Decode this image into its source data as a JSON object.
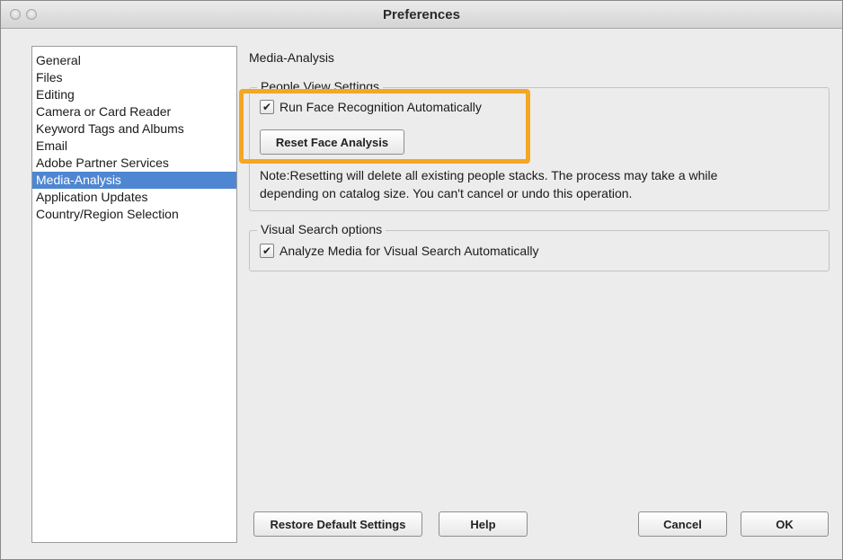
{
  "window": {
    "title": "Preferences"
  },
  "sidebar": {
    "items": [
      {
        "label": "General"
      },
      {
        "label": "Files"
      },
      {
        "label": "Editing"
      },
      {
        "label": "Camera or Card Reader"
      },
      {
        "label": "Keyword Tags and Albums"
      },
      {
        "label": "Email"
      },
      {
        "label": "Adobe Partner Services"
      },
      {
        "label": "Media-Analysis",
        "selected": true
      },
      {
        "label": "Application Updates"
      },
      {
        "label": "Country/Region Selection"
      }
    ]
  },
  "main": {
    "section_title": "Media-Analysis",
    "people_view": {
      "legend": "People View Settings",
      "run_face_recognition": {
        "label": "Run Face Recognition Automatically",
        "checked": true
      },
      "reset_button": "Reset Face Analysis",
      "note_line1": "Note:Resetting will delete all existing people stacks. The process may take a while",
      "note_line2": "depending on catalog size. You can't cancel or undo this operation."
    },
    "visual_search": {
      "legend": "Visual Search options",
      "analyze_media": {
        "label": "Analyze Media for Visual Search Automatically",
        "checked": true
      }
    }
  },
  "footer": {
    "restore_button": "Restore Default Settings",
    "help_button": "Help",
    "cancel_button": "Cancel",
    "ok_button": "OK"
  },
  "colors": {
    "selection": "#4f86d2",
    "highlight": "#f5a623"
  },
  "icons": {
    "checkmark": "✔"
  }
}
